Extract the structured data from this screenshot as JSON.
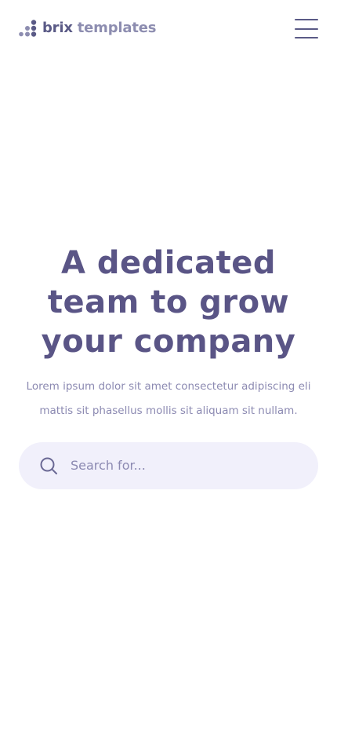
{
  "brand": {
    "part1": "brix",
    "part2": "templates",
    "logo_icon": "dots-logo-icon"
  },
  "header": {
    "menu_icon": "hamburger-menu-icon"
  },
  "hero": {
    "title_line1": "A dedicated",
    "title_line2": "team to grow",
    "title_line3": "your company",
    "text_line1": "Lorem ipsum dolor sit amet consectetur adipiscing eli",
    "text_line2": "mattis sit phasellus mollis sit aliquam sit nullam."
  },
  "search": {
    "placeholder": "Search for...",
    "icon": "search-icon"
  },
  "colors": {
    "primary": "#5a5586",
    "secondary": "#8c8ab2",
    "field_background": "#f1f0fb",
    "background": "#ffffff"
  }
}
